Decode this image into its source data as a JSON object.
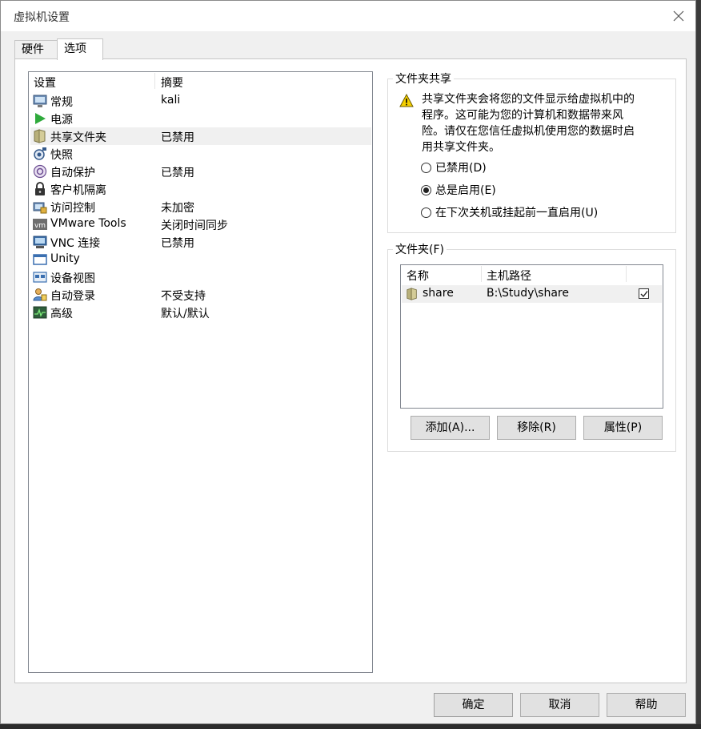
{
  "window": {
    "title": "虚拟机设置"
  },
  "tabs": [
    {
      "label": "硬件"
    },
    {
      "label": "选项"
    }
  ],
  "settings": {
    "col_setting": "设置",
    "col_summary": "摘要",
    "items": [
      {
        "name": "常规",
        "summary": "kali",
        "icon": "monitor-icon"
      },
      {
        "name": "电源",
        "summary": "",
        "icon": "play-icon"
      },
      {
        "name": "共享文件夹",
        "summary": "已禁用",
        "icon": "shared-folder-icon"
      },
      {
        "name": "快照",
        "summary": "",
        "icon": "snapshot-icon"
      },
      {
        "name": "自动保护",
        "summary": "已禁用",
        "icon": "autoprotect-icon"
      },
      {
        "name": "客户机隔离",
        "summary": "",
        "icon": "lock-icon"
      },
      {
        "name": "访问控制",
        "summary": "未加密",
        "icon": "access-control-icon"
      },
      {
        "name": "VMware Tools",
        "summary": "关闭时间同步",
        "icon": "vmware-tools-icon"
      },
      {
        "name": "VNC 连接",
        "summary": "已禁用",
        "icon": "vnc-icon"
      },
      {
        "name": "Unity",
        "summary": "",
        "icon": "unity-icon"
      },
      {
        "name": "设备视图",
        "summary": "",
        "icon": "device-view-icon"
      },
      {
        "name": "自动登录",
        "summary": "不受支持",
        "icon": "autologin-icon"
      },
      {
        "name": "高级",
        "summary": "默认/默认",
        "icon": "advanced-icon"
      }
    ]
  },
  "folder_sharing": {
    "title": "文件夹共享",
    "warning": "共享文件夹会将您的文件显示给虚拟机中的程序。这可能为您的计算机和数据带来风险。请仅在您信任虚拟机使用您的数据时启用共享文件夹。",
    "options": [
      {
        "label": "已禁用(D)",
        "selected": false
      },
      {
        "label": "总是启用(E)",
        "selected": true
      },
      {
        "label": "在下次关机或挂起前一直启用(U)",
        "selected": false
      }
    ]
  },
  "folders": {
    "title": "文件夹(F)",
    "col_name": "名称",
    "col_path": "主机路径",
    "rows": [
      {
        "name": "share",
        "path": "B:\\Study\\share",
        "enabled": true
      }
    ],
    "add_label": "添加(A)...",
    "remove_label": "移除(R)",
    "properties_label": "属性(P)"
  },
  "footer": {
    "ok_label": "确定",
    "cancel_label": "取消",
    "help_label": "帮助"
  },
  "colors": {
    "accent_green": "#2faa3c",
    "folder_khaki": "#b8b07a",
    "warning_yellow": "#f5d000"
  }
}
